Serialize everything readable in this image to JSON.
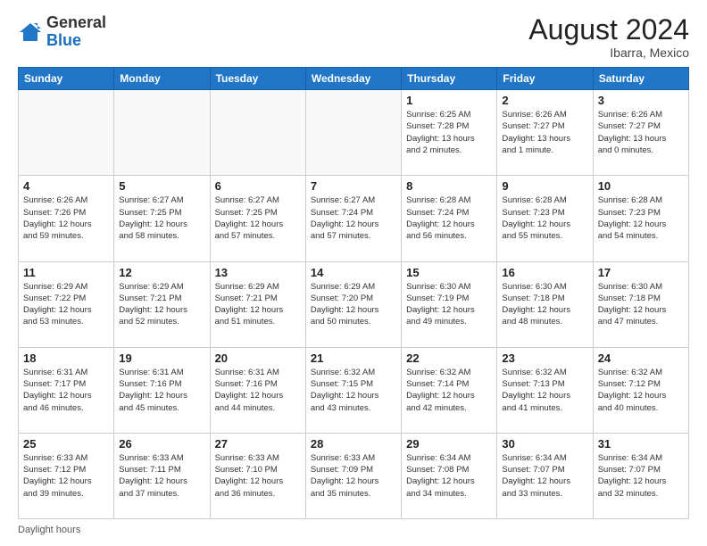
{
  "logo": {
    "general": "General",
    "blue": "Blue"
  },
  "header": {
    "month_year": "August 2024",
    "location": "Ibarra, Mexico"
  },
  "days_of_week": [
    "Sunday",
    "Monday",
    "Tuesday",
    "Wednesday",
    "Thursday",
    "Friday",
    "Saturday"
  ],
  "footer": {
    "daylight_label": "Daylight hours"
  },
  "weeks": [
    {
      "days": [
        {
          "num": "",
          "info": ""
        },
        {
          "num": "",
          "info": ""
        },
        {
          "num": "",
          "info": ""
        },
        {
          "num": "",
          "info": ""
        },
        {
          "num": "1",
          "info": "Sunrise: 6:25 AM\nSunset: 7:28 PM\nDaylight: 13 hours\nand 2 minutes."
        },
        {
          "num": "2",
          "info": "Sunrise: 6:26 AM\nSunset: 7:27 PM\nDaylight: 13 hours\nand 1 minute."
        },
        {
          "num": "3",
          "info": "Sunrise: 6:26 AM\nSunset: 7:27 PM\nDaylight: 13 hours\nand 0 minutes."
        }
      ]
    },
    {
      "days": [
        {
          "num": "4",
          "info": "Sunrise: 6:26 AM\nSunset: 7:26 PM\nDaylight: 12 hours\nand 59 minutes."
        },
        {
          "num": "5",
          "info": "Sunrise: 6:27 AM\nSunset: 7:25 PM\nDaylight: 12 hours\nand 58 minutes."
        },
        {
          "num": "6",
          "info": "Sunrise: 6:27 AM\nSunset: 7:25 PM\nDaylight: 12 hours\nand 57 minutes."
        },
        {
          "num": "7",
          "info": "Sunrise: 6:27 AM\nSunset: 7:24 PM\nDaylight: 12 hours\nand 57 minutes."
        },
        {
          "num": "8",
          "info": "Sunrise: 6:28 AM\nSunset: 7:24 PM\nDaylight: 12 hours\nand 56 minutes."
        },
        {
          "num": "9",
          "info": "Sunrise: 6:28 AM\nSunset: 7:23 PM\nDaylight: 12 hours\nand 55 minutes."
        },
        {
          "num": "10",
          "info": "Sunrise: 6:28 AM\nSunset: 7:23 PM\nDaylight: 12 hours\nand 54 minutes."
        }
      ]
    },
    {
      "days": [
        {
          "num": "11",
          "info": "Sunrise: 6:29 AM\nSunset: 7:22 PM\nDaylight: 12 hours\nand 53 minutes."
        },
        {
          "num": "12",
          "info": "Sunrise: 6:29 AM\nSunset: 7:21 PM\nDaylight: 12 hours\nand 52 minutes."
        },
        {
          "num": "13",
          "info": "Sunrise: 6:29 AM\nSunset: 7:21 PM\nDaylight: 12 hours\nand 51 minutes."
        },
        {
          "num": "14",
          "info": "Sunrise: 6:29 AM\nSunset: 7:20 PM\nDaylight: 12 hours\nand 50 minutes."
        },
        {
          "num": "15",
          "info": "Sunrise: 6:30 AM\nSunset: 7:19 PM\nDaylight: 12 hours\nand 49 minutes."
        },
        {
          "num": "16",
          "info": "Sunrise: 6:30 AM\nSunset: 7:18 PM\nDaylight: 12 hours\nand 48 minutes."
        },
        {
          "num": "17",
          "info": "Sunrise: 6:30 AM\nSunset: 7:18 PM\nDaylight: 12 hours\nand 47 minutes."
        }
      ]
    },
    {
      "days": [
        {
          "num": "18",
          "info": "Sunrise: 6:31 AM\nSunset: 7:17 PM\nDaylight: 12 hours\nand 46 minutes."
        },
        {
          "num": "19",
          "info": "Sunrise: 6:31 AM\nSunset: 7:16 PM\nDaylight: 12 hours\nand 45 minutes."
        },
        {
          "num": "20",
          "info": "Sunrise: 6:31 AM\nSunset: 7:16 PM\nDaylight: 12 hours\nand 44 minutes."
        },
        {
          "num": "21",
          "info": "Sunrise: 6:32 AM\nSunset: 7:15 PM\nDaylight: 12 hours\nand 43 minutes."
        },
        {
          "num": "22",
          "info": "Sunrise: 6:32 AM\nSunset: 7:14 PM\nDaylight: 12 hours\nand 42 minutes."
        },
        {
          "num": "23",
          "info": "Sunrise: 6:32 AM\nSunset: 7:13 PM\nDaylight: 12 hours\nand 41 minutes."
        },
        {
          "num": "24",
          "info": "Sunrise: 6:32 AM\nSunset: 7:12 PM\nDaylight: 12 hours\nand 40 minutes."
        }
      ]
    },
    {
      "days": [
        {
          "num": "25",
          "info": "Sunrise: 6:33 AM\nSunset: 7:12 PM\nDaylight: 12 hours\nand 39 minutes."
        },
        {
          "num": "26",
          "info": "Sunrise: 6:33 AM\nSunset: 7:11 PM\nDaylight: 12 hours\nand 37 minutes."
        },
        {
          "num": "27",
          "info": "Sunrise: 6:33 AM\nSunset: 7:10 PM\nDaylight: 12 hours\nand 36 minutes."
        },
        {
          "num": "28",
          "info": "Sunrise: 6:33 AM\nSunset: 7:09 PM\nDaylight: 12 hours\nand 35 minutes."
        },
        {
          "num": "29",
          "info": "Sunrise: 6:34 AM\nSunset: 7:08 PM\nDaylight: 12 hours\nand 34 minutes."
        },
        {
          "num": "30",
          "info": "Sunrise: 6:34 AM\nSunset: 7:07 PM\nDaylight: 12 hours\nand 33 minutes."
        },
        {
          "num": "31",
          "info": "Sunrise: 6:34 AM\nSunset: 7:07 PM\nDaylight: 12 hours\nand 32 minutes."
        }
      ]
    }
  ]
}
